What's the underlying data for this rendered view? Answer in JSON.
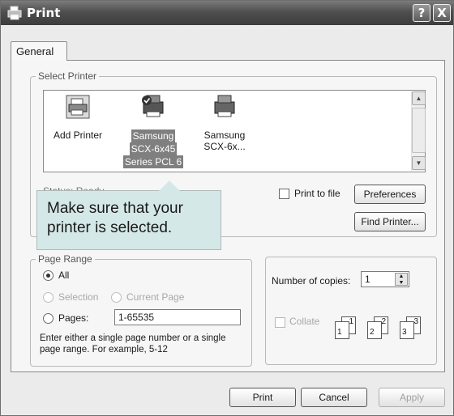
{
  "window": {
    "title": "Print",
    "help_button": "?",
    "close_button": "X"
  },
  "tabs": [
    {
      "label": "General",
      "active": true
    }
  ],
  "select_printer": {
    "legend": "Select Printer",
    "printers": [
      {
        "label": "Add Printer",
        "icon": "add-printer-icon",
        "selected": false
      },
      {
        "label": "Samsung SCX-6x45 Series PCL 6",
        "lines": [
          "Samsung",
          "SCX-6x45",
          "Series PCL 6"
        ],
        "icon": "printer-icon",
        "selected": true
      },
      {
        "label": "Samsung SCX-6x...",
        "lines": [
          "Samsung",
          "SCX-6x..."
        ],
        "icon": "printer-icon",
        "selected": false
      }
    ],
    "print_to_file_label": "Print to file",
    "preferences_label": "Preferences",
    "find_printer_label": "Find Printer...",
    "partial_label": "Status: Ready"
  },
  "callout": {
    "text": "Make sure that your printer is selected."
  },
  "page_range": {
    "legend": "Page Range",
    "all_label": "All",
    "selection_label": "Selection",
    "current_page_label": "Current Page",
    "pages_label": "Pages:",
    "pages_value": "1-65535",
    "help_text_line1": "Enter either a single page number or a single",
    "help_text_line2": "page range.  For example, 5-12",
    "selected": "All"
  },
  "copies": {
    "label": "Number of copies:",
    "value": "1",
    "collate_label": "Collate",
    "collate_pages": [
      [
        "1",
        "1"
      ],
      [
        "2",
        "2"
      ],
      [
        "3",
        "3"
      ]
    ]
  },
  "buttons": {
    "print": "Print",
    "cancel": "Cancel",
    "apply": "Apply"
  },
  "colors": {
    "titlebar": "#4f4f4f",
    "callout": "#d5e8e8",
    "selection": "#7f7f7f"
  }
}
